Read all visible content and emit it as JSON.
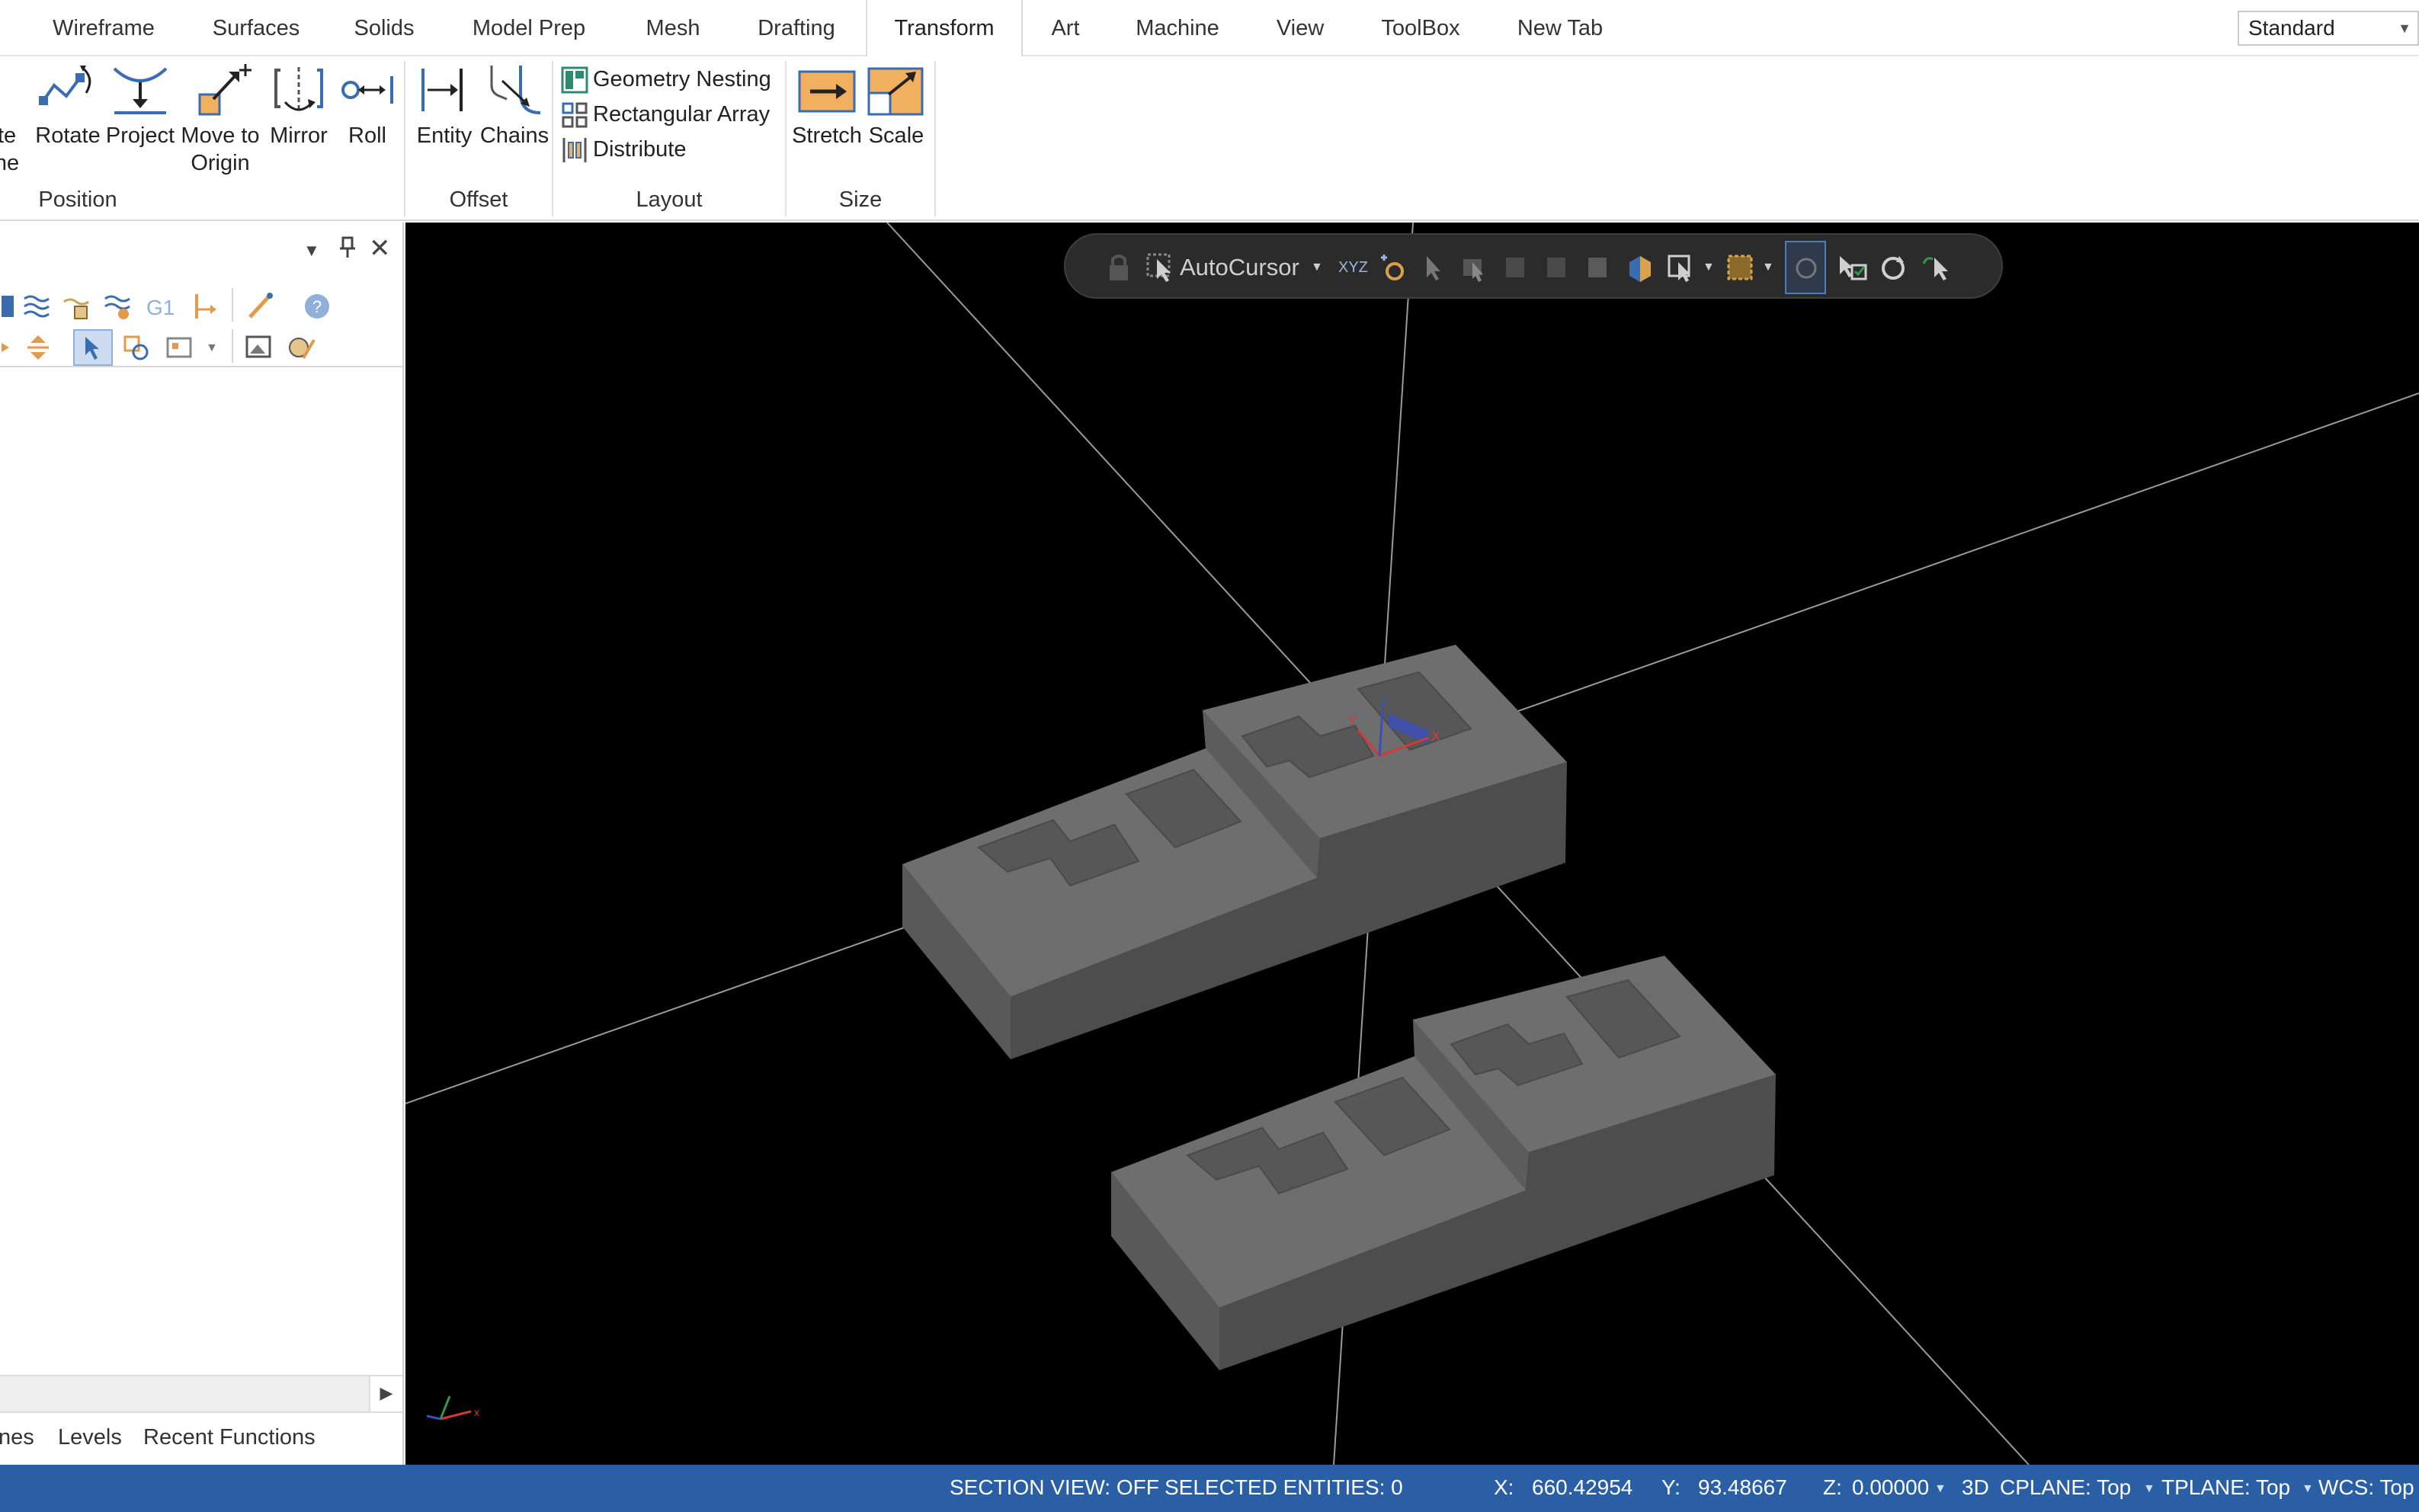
{
  "tabs": [
    {
      "label": "Wireframe"
    },
    {
      "label": "Surfaces"
    },
    {
      "label": "Solids"
    },
    {
      "label": "Model Prep"
    },
    {
      "label": "Mesh"
    },
    {
      "label": "Drafting"
    },
    {
      "label": "Transform",
      "active": true
    },
    {
      "label": "Art"
    },
    {
      "label": "Machine"
    },
    {
      "label": "View"
    },
    {
      "label": "ToolBox"
    },
    {
      "label": "New Tab"
    }
  ],
  "view_select": {
    "value": "Standard"
  },
  "ribbon": {
    "position": {
      "label": "Position",
      "buttons": [
        {
          "label_line1": "ate",
          "label_line2": "ane"
        },
        {
          "label_line1": "Rotate",
          "label_line2": ""
        },
        {
          "label_line1": "Project",
          "label_line2": ""
        },
        {
          "label_line1": "Move to",
          "label_line2": "Origin"
        },
        {
          "label_line1": "Mirror",
          "label_line2": ""
        },
        {
          "label_line1": "Roll",
          "label_line2": ""
        }
      ]
    },
    "offset": {
      "label": "Offset",
      "buttons": [
        {
          "label_line1": "Entity"
        },
        {
          "label_line1": "Chains"
        }
      ]
    },
    "layout": {
      "label": "Layout",
      "items": [
        {
          "label": "Geometry Nesting"
        },
        {
          "label": "Rectangular Array"
        },
        {
          "label": "Distribute"
        }
      ]
    },
    "size": {
      "label": "Size",
      "buttons": [
        {
          "label_line1": "Stretch"
        },
        {
          "label_line1": "Scale"
        }
      ]
    }
  },
  "left_panel": {
    "toolbar_text_g1": "G1",
    "bottom_tabs": [
      {
        "label": "nes"
      },
      {
        "label": "Levels"
      },
      {
        "label": "Recent Functions"
      }
    ]
  },
  "floating_toolbar": {
    "autocursor_label": "AutoCursor",
    "xyz_label": "XYZ"
  },
  "status_bar": {
    "section_view": "SECTION VIEW: OFF",
    "selected_entities": "SELECTED ENTITIES: 0",
    "x_label": "X:",
    "x_value": "660.42954",
    "y_label": "Y:",
    "y_value": "93.48667",
    "z_label": "Z:",
    "z_value": "0.00000",
    "mode": "3D",
    "cplane": "CPLANE: Top",
    "tplane": "TPLANE: Top",
    "wcs": "WCS: Top"
  },
  "colors": {
    "status_bar": "#2a5fa6",
    "viewport_bg": "#000000",
    "ribbon_accent": "#f0b060",
    "icon_blue": "#2f6db5"
  }
}
